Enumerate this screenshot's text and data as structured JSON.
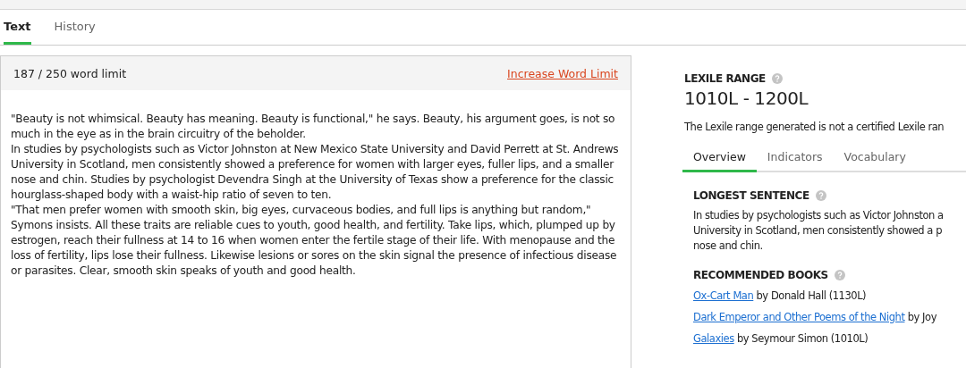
{
  "tabs": [
    {
      "label": "Text",
      "selected": true
    },
    {
      "label": "History",
      "selected": false
    }
  ],
  "editor": {
    "word_count": "187 / 250 word limit",
    "increase_link": "Increase Word Limit",
    "paragraphs": [
      "\"Beauty is not whimsical. Beauty has meaning. Beauty is functional,\" he says. Beauty, his argument goes, is not so much in the eye as in the brain circuitry of the beholder.",
      "In studies by psychologists such as Victor Johnston at New Mexico State University and David Perrett at St. Andrews University in Scotland, men consistently showed a preference for women with larger eyes, fuller lips, and a smaller nose and chin. Studies by psychologist Devendra Singh at the University of Texas show a preference for the classic hourglass-shaped body with a waist-hip ratio of seven to ten.",
      "\"That men prefer women with smooth skin, big eyes, curvaceous bodies, and full lips is anything but random,\" Symons insists. All these traits are reliable cues to youth, good health, and fertility. Take lips, which, plumped up by estrogen, reach their fullness at 14 to 16 when women enter the fertile stage of their life. With menopause and the loss of fertility, lips lose their fullness. Likewise lesions or sores on the skin signal the presence of infectious disease or parasites. Clear, smooth skin speaks of youth and good health."
    ]
  },
  "lexile": {
    "heading": "LEXILE RANGE",
    "range": "1010L - 1200L",
    "note": "The Lexile range generated is not a certified Lexile ran"
  },
  "detail_tabs": [
    {
      "label": "Overview",
      "selected": true
    },
    {
      "label": "Indicators",
      "selected": false
    },
    {
      "label": "Vocabulary",
      "selected": false
    }
  ],
  "longest_sentence": {
    "heading": "LONGEST SENTENCE",
    "lines": [
      "In studies by psychologists such as Victor Johnston a",
      "University in Scotland, men consistently showed a p",
      "nose and chin."
    ]
  },
  "recommended_books": {
    "heading": "RECOMMENDED BOOKS",
    "books": [
      {
        "title": "Ox-Cart Man",
        "byline": "by Donald Hall (1130L)"
      },
      {
        "title": "Dark Emperor and Other Poems of the Night",
        "byline": "by Joy"
      },
      {
        "title": "Galaxies",
        "byline": "by Seymour Simon (1010L)"
      }
    ]
  }
}
